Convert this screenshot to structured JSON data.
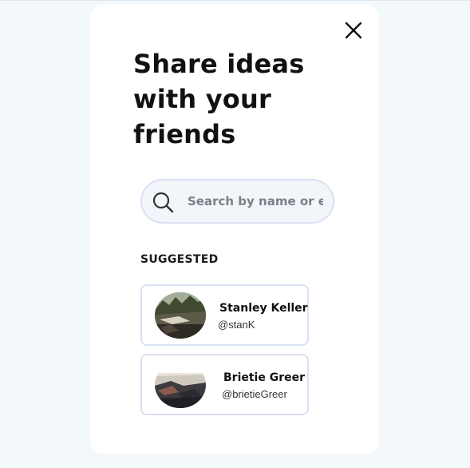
{
  "modal": {
    "title": "Share ideas with your friends",
    "close_icon": "close-icon"
  },
  "search": {
    "icon": "search-icon",
    "placeholder": "Search by name or email",
    "value": ""
  },
  "suggested": {
    "label": "SUGGESTED",
    "users": [
      {
        "name": "Stanley Keller",
        "handle": "@stanK"
      },
      {
        "name": "Brietie Greer",
        "handle": "@brietieGreer"
      }
    ]
  },
  "colors": {
    "background": "#f3f8fb",
    "card_border": "#d9e1f2",
    "search_fill": "#f2f6fb",
    "text": "#111111"
  }
}
